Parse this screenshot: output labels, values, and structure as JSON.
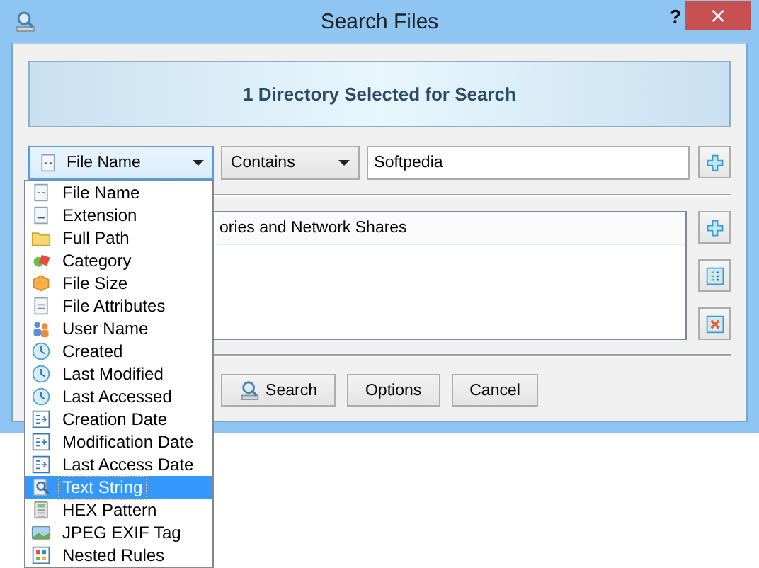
{
  "window": {
    "title": "Search Files",
    "help": "?",
    "close": "×"
  },
  "banner": "1 Directory Selected for Search",
  "criteria": {
    "field": "File Name",
    "operator": "Contains",
    "value": "Softpedia"
  },
  "locations": [
    "ories and Network Shares"
  ],
  "buttons": [
    "Search",
    "Options",
    "Cancel"
  ],
  "field_menu": [
    {
      "label": "File Name",
      "selected": false
    },
    {
      "label": "Extension",
      "selected": false
    },
    {
      "label": "Full Path",
      "selected": false
    },
    {
      "label": "Category",
      "selected": false
    },
    {
      "label": "File Size",
      "selected": false
    },
    {
      "label": "File Attributes",
      "selected": false
    },
    {
      "label": "User Name",
      "selected": false
    },
    {
      "label": "Created",
      "selected": false
    },
    {
      "label": "Last Modified",
      "selected": false
    },
    {
      "label": "Last Accessed",
      "selected": false
    },
    {
      "label": "Creation Date",
      "selected": false
    },
    {
      "label": "Modification Date",
      "selected": false
    },
    {
      "label": "Last Access Date",
      "selected": false
    },
    {
      "label": "Text String",
      "selected": true
    },
    {
      "label": "HEX Pattern",
      "selected": false
    },
    {
      "label": "JPEG EXIF Tag",
      "selected": false
    },
    {
      "label": "Nested Rules",
      "selected": false
    }
  ]
}
